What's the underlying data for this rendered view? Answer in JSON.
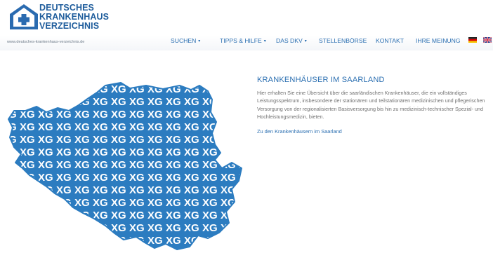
{
  "logo": {
    "lines": [
      "DEUTSCHES",
      "KRANKENHAUS",
      "VERZEICHNIS"
    ],
    "url": "www.deutsches-krankenhaus-verzeichnis.de"
  },
  "nav": {
    "items": [
      {
        "label": "SUCHEN",
        "dropdown": true
      },
      {
        "label": "TIPPS & HILFE",
        "dropdown": true
      },
      {
        "label": "DAS DKV",
        "dropdown": true
      },
      {
        "label": "STELLENBÖRSE",
        "dropdown": false
      },
      {
        "label": "KONTAKT",
        "dropdown": false
      },
      {
        "label": "IHRE MEINUNG",
        "dropdown": false
      }
    ],
    "caret": "▾",
    "flags": [
      "german-flag-icon",
      "uk-flag-icon"
    ]
  },
  "main": {
    "title": "KRANKENHÄUSER IM SAARLAND",
    "description": "Hier erhalten Sie eine Übersicht über die saarländischen Krankenhäuser, die ein vollständiges Leistungsspektrum, insbesondere der stationären und teilstationären medizinischen und pflegerischen Versorgung von der regionalisierten Basisversorgung bis hin zu medizinisch-technischer Spezial- und Hochleistungsmedizin, bieten.",
    "link": "Zu den Krankenhäusern im Saarland"
  },
  "colors": {
    "brand_blue": "#2b6fb1",
    "logo_blue": "#1f5d9c",
    "map_blue": "#2c7cc0"
  }
}
